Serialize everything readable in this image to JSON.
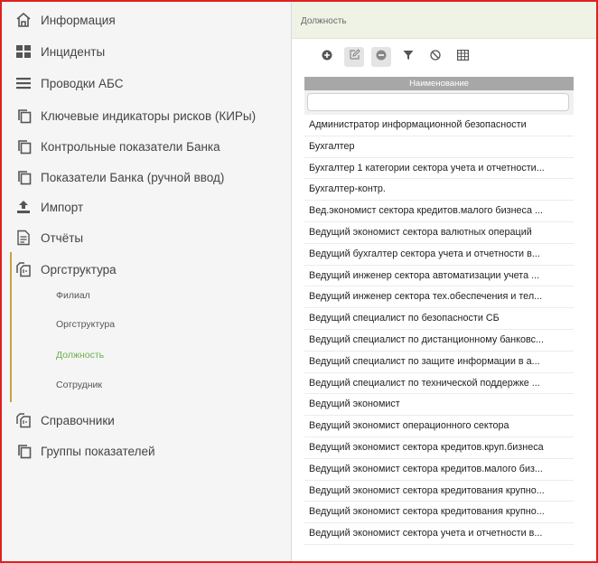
{
  "sidebar": {
    "items": [
      {
        "label": "Информация",
        "icon": "home-icon"
      },
      {
        "label": "Инциденты",
        "icon": "grid-icon"
      },
      {
        "label": "Проводки АБС",
        "icon": "menu-lines-icon"
      },
      {
        "label": "Ключевые индикаторы рисков (КИРы)",
        "icon": "copy-icon"
      },
      {
        "label": "Контрольные показатели Банка",
        "icon": "copy-icon"
      },
      {
        "label": "Показатели Банка (ручной ввод)",
        "icon": "copy-icon"
      },
      {
        "label": "Импорт",
        "icon": "upload-icon"
      },
      {
        "label": "Отчёты",
        "icon": "document-icon"
      },
      {
        "label": "Оргструктура",
        "icon": "org-copy-icon"
      }
    ],
    "subitems": [
      {
        "label": "Филиал"
      },
      {
        "label": "Оргструктура"
      },
      {
        "label": "Должность",
        "active": true
      },
      {
        "label": "Сотрудник"
      }
    ],
    "items_after": [
      {
        "label": "Справочники",
        "icon": "org-copy-icon"
      },
      {
        "label": "Группы показателей",
        "icon": "copy-icon"
      }
    ],
    "active_color": "#6ab04c",
    "group_bar_color": "#c9a33b"
  },
  "panel": {
    "title": "Должность",
    "toolbar": [
      "add-icon",
      "edit-icon",
      "remove-icon",
      "filter-icon",
      "cancel-icon",
      "table-icon"
    ],
    "grid": {
      "column_header": "Наименование",
      "filter_value": "",
      "rows": [
        "Администратор информационной безопасности",
        "Бухгалтер",
        "Бухгалтер 1 категории сектора учета и отчетности...",
        "Бухгалтер-контр.",
        "Вед.экономист сектора кредитов.малого бизнеса ...",
        "Ведущий экономист сектора валютных операций",
        "Ведущий бухгалтер сектора учета и отчетности в...",
        "Ведущий инженер сектора автоматизации учета ...",
        "Ведущий инженер сектора тех.обеспечения и тел...",
        "Ведущий специалист по безопасности СБ",
        "Ведущий специалист по дистанционному банковс...",
        "Ведущий специалист по защите информации в а...",
        "Ведущий специалист по технической поддержке ...",
        "Ведущий экономист",
        "Ведущий экономист операционного сектора",
        "Ведущий экономист сектора кредитов.круп.бизнеса",
        "Ведущий экономист сектора кредитов.малого биз...",
        "Ведущий экономист сектора кредитования крупно...",
        "Ведущий экономист сектора кредитования крупно...",
        "Ведущий экономист сектора учета и отчетности в..."
      ]
    }
  },
  "colors": {
    "frame_border": "#e02020",
    "header_bg": "#eef3e6",
    "grid_header_bg": "#a7a7a7"
  }
}
